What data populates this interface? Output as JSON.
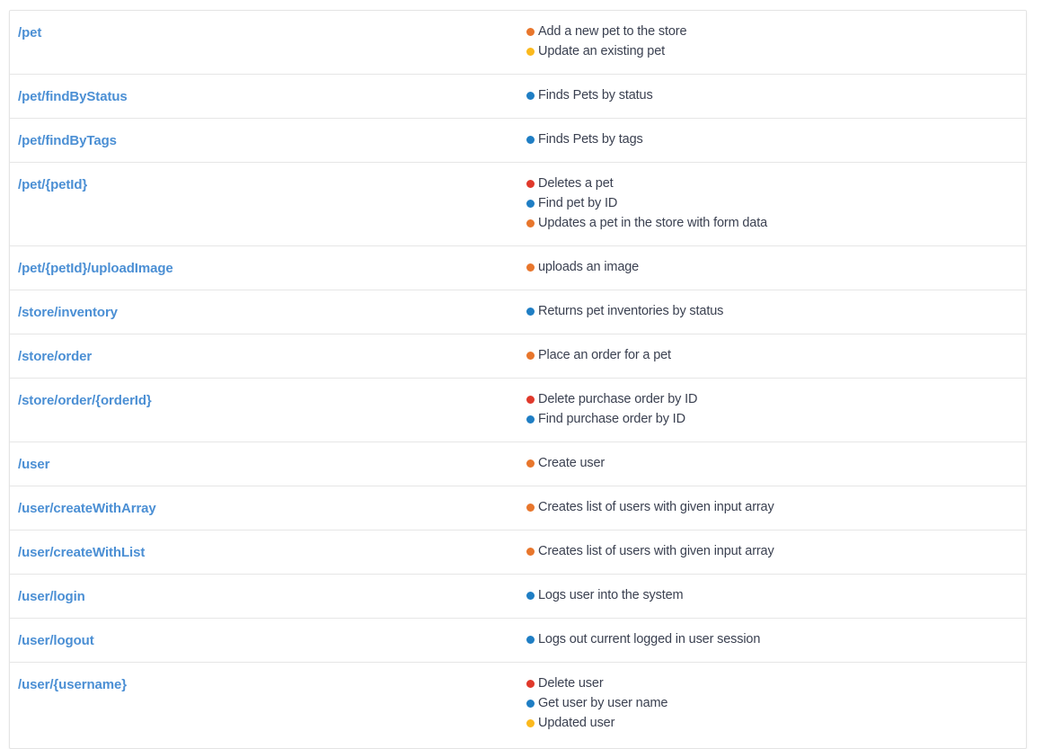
{
  "method_colors": {
    "get": "#1f7ec4",
    "post": "#e8762c",
    "put": "#fbb91d",
    "delete": "#e0392b"
  },
  "link_color": "#4b8fd4",
  "text_color": "#3b4151",
  "table": {
    "rows": [
      {
        "path": "/pet",
        "operations": [
          {
            "method": "post",
            "summary": "Add a new pet to the store",
            "dot": "post-dot"
          },
          {
            "method": "put",
            "summary": "Update an existing pet",
            "dot": "put-dot"
          }
        ]
      },
      {
        "path": "/pet/findByStatus",
        "operations": [
          {
            "method": "get",
            "summary": "Finds Pets by status",
            "dot": "get-dot"
          }
        ]
      },
      {
        "path": "/pet/findByTags",
        "operations": [
          {
            "method": "get",
            "summary": "Finds Pets by tags",
            "dot": "get-dot"
          }
        ]
      },
      {
        "path": "/pet/{petId}",
        "operations": [
          {
            "method": "delete",
            "summary": "Deletes a pet",
            "dot": "delete-dot"
          },
          {
            "method": "get",
            "summary": "Find pet by ID",
            "dot": "get-dot"
          },
          {
            "method": "post",
            "summary": "Updates a pet in the store with form data",
            "dot": "post-dot"
          }
        ]
      },
      {
        "path": "/pet/{petId}/uploadImage",
        "operations": [
          {
            "method": "post",
            "summary": "uploads an image",
            "dot": "post-dot"
          }
        ]
      },
      {
        "path": "/store/inventory",
        "operations": [
          {
            "method": "get",
            "summary": "Returns pet inventories by status",
            "dot": "get-dot"
          }
        ]
      },
      {
        "path": "/store/order",
        "operations": [
          {
            "method": "post",
            "summary": "Place an order for a pet",
            "dot": "post-dot"
          }
        ]
      },
      {
        "path": "/store/order/{orderId}",
        "operations": [
          {
            "method": "delete",
            "summary": "Delete purchase order by ID",
            "dot": "delete-dot"
          },
          {
            "method": "get",
            "summary": "Find purchase order by ID",
            "dot": "get-dot"
          }
        ]
      },
      {
        "path": "/user",
        "operations": [
          {
            "method": "post",
            "summary": "Create user",
            "dot": "post-dot"
          }
        ]
      },
      {
        "path": "/user/createWithArray",
        "operations": [
          {
            "method": "post",
            "summary": "Creates list of users with given input array",
            "dot": "post-dot"
          }
        ]
      },
      {
        "path": "/user/createWithList",
        "operations": [
          {
            "method": "post",
            "summary": "Creates list of users with given input array",
            "dot": "post-dot"
          }
        ]
      },
      {
        "path": "/user/login",
        "operations": [
          {
            "method": "get",
            "summary": "Logs user into the system",
            "dot": "get-dot"
          }
        ]
      },
      {
        "path": "/user/logout",
        "operations": [
          {
            "method": "get",
            "summary": "Logs out current logged in user session",
            "dot": "get-dot"
          }
        ]
      },
      {
        "path": "/user/{username}",
        "operations": [
          {
            "method": "delete",
            "summary": "Delete user",
            "dot": "delete-dot"
          },
          {
            "method": "get",
            "summary": "Get user by user name",
            "dot": "get-dot"
          },
          {
            "method": "put",
            "summary": "Updated user",
            "dot": "put-dot"
          }
        ]
      }
    ]
  }
}
